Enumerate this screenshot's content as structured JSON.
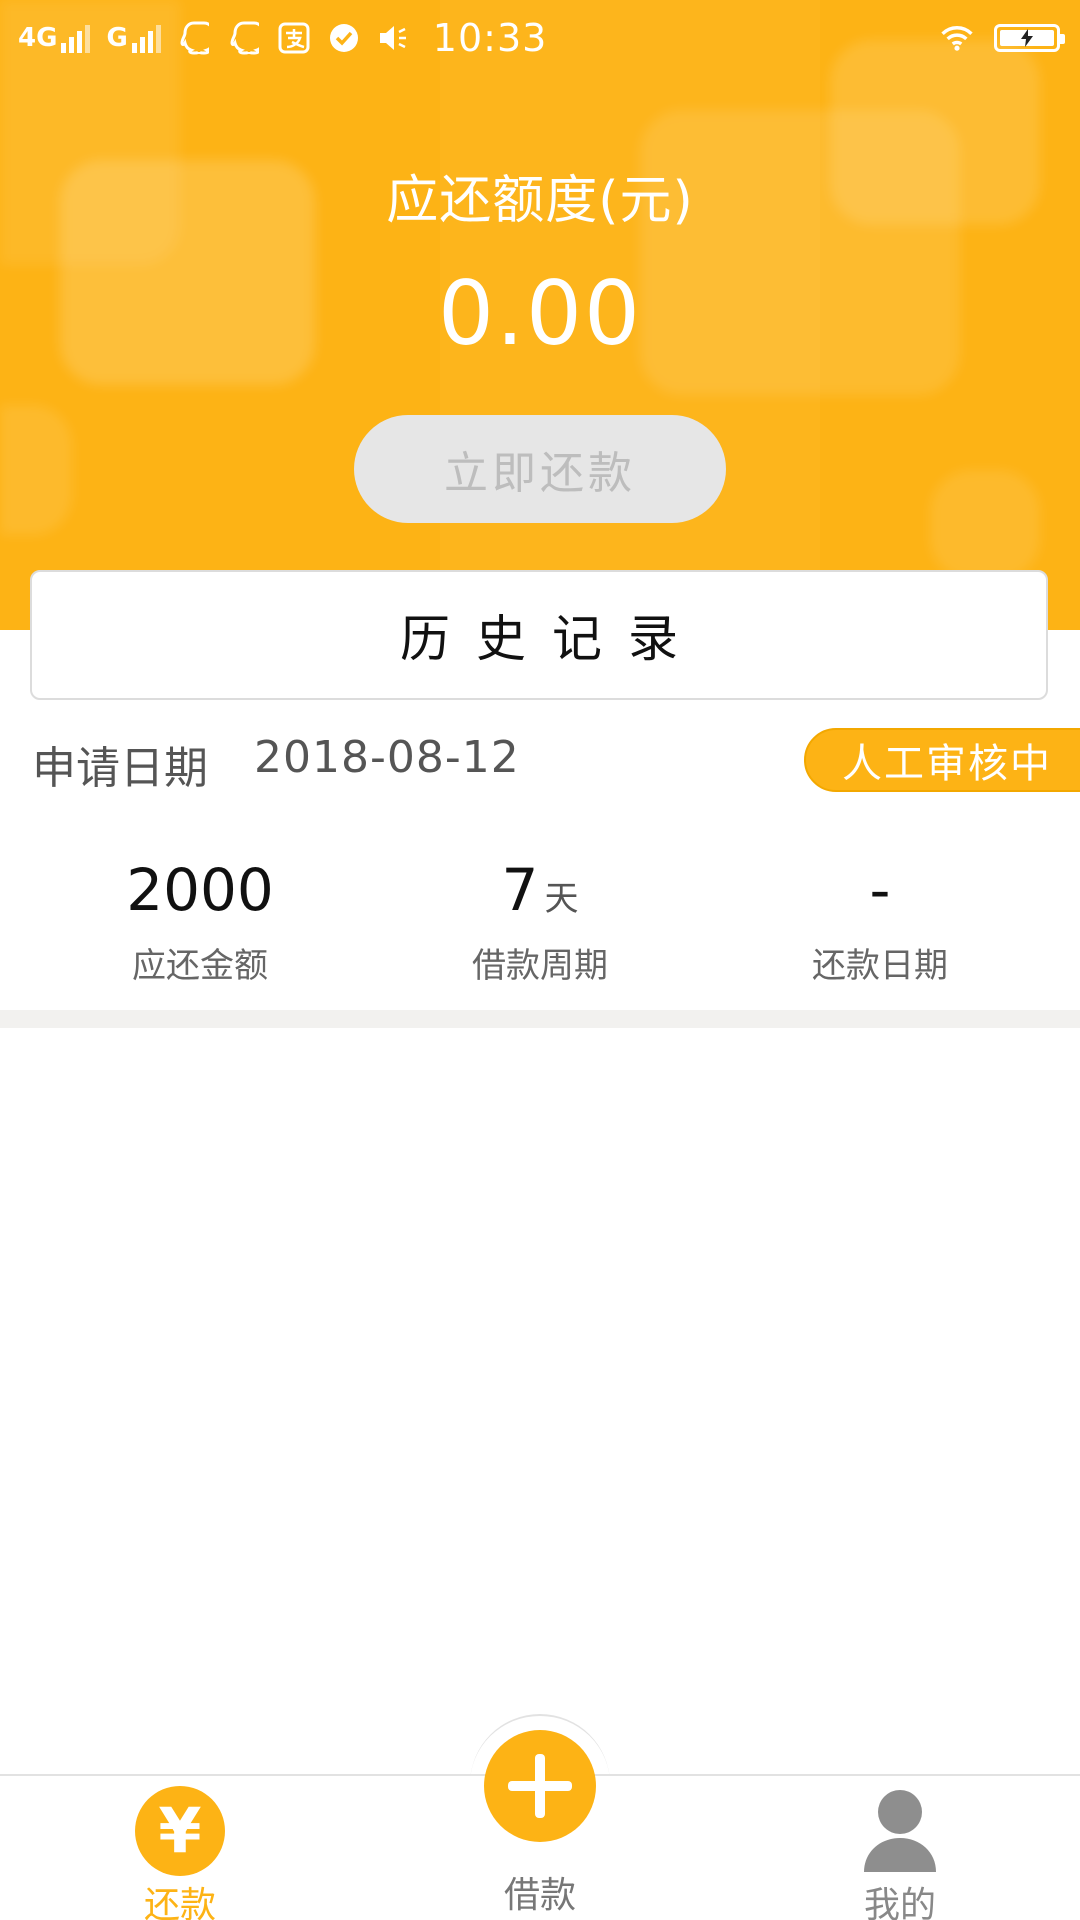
{
  "status_bar": {
    "network_1": "4G",
    "network_2": "G",
    "time": "10:33",
    "icons": [
      "qq-icon",
      "qq-icon",
      "alipay-icon",
      "check-circle-icon",
      "volume-icon",
      "wifi-icon",
      "battery-charging-icon"
    ]
  },
  "header": {
    "quota_title": "应还额度(元)",
    "quota_value": "0.00",
    "repay_button_label": "立即还款"
  },
  "history_button_label": "历史记录",
  "application": {
    "date_label": "申请日期",
    "date_value": "2018-08-12",
    "status": "人工审核中"
  },
  "stats": [
    {
      "value": "2000",
      "unit": "",
      "label": "应还金额"
    },
    {
      "value": "7",
      "unit": "天",
      "label": "借款周期"
    },
    {
      "value": "-",
      "unit": "",
      "label": "还款日期"
    }
  ],
  "bottom_nav": {
    "repay_label": "还款",
    "repay_icon": "¥",
    "borrow_label": "借款",
    "mine_label": "我的"
  },
  "colors": {
    "accent": "#fdb315",
    "button_disabled_bg": "#e6e6e6",
    "divider": "#f2f1ef"
  }
}
